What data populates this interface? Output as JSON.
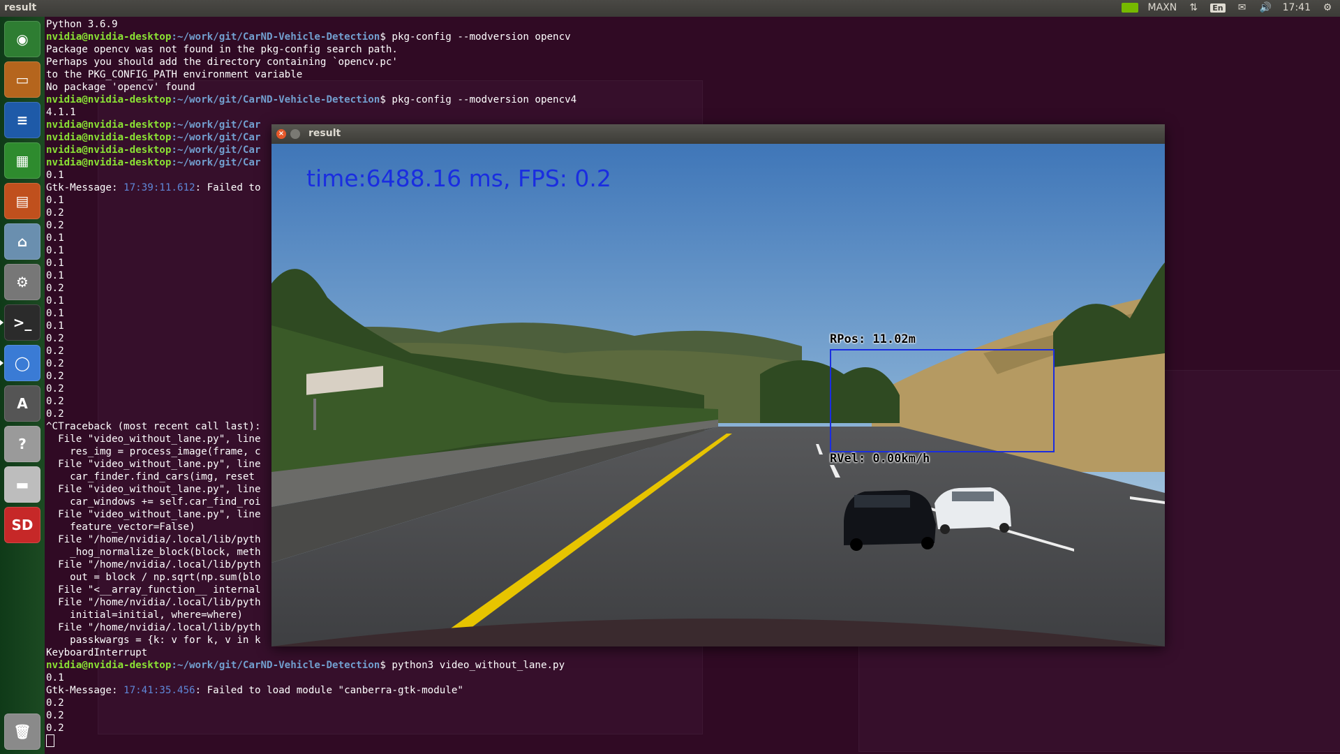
{
  "top_panel": {
    "app_title": "result",
    "nvidia_mode": "MAXN",
    "input_lang": "En",
    "clock": "17:41",
    "icons": [
      "nvidia-icon",
      "network-icon",
      "keyboard-icon",
      "mail-icon",
      "volume-icon",
      "gear-icon"
    ]
  },
  "launcher": {
    "items": [
      {
        "name": "launcher-ubuntu-icon",
        "glyph": "◉",
        "color": "#2e7d32"
      },
      {
        "name": "launcher-files-icon",
        "glyph": "▭",
        "color": "#b5651d"
      },
      {
        "name": "launcher-writer-icon",
        "glyph": "≡",
        "color": "#1e5aa8"
      },
      {
        "name": "launcher-calc-icon",
        "glyph": "▦",
        "color": "#2e8b2e"
      },
      {
        "name": "launcher-impress-icon",
        "glyph": "▤",
        "color": "#c0501d"
      },
      {
        "name": "launcher-software-icon",
        "glyph": "⌂",
        "color": "#6a8faf"
      },
      {
        "name": "launcher-settings-icon",
        "glyph": "⚙",
        "color": "#777777"
      },
      {
        "name": "launcher-terminal-icon",
        "glyph": ">_",
        "color": "#2b2b2b"
      },
      {
        "name": "launcher-chromium-icon",
        "glyph": "◯",
        "color": "#3a7bd5"
      },
      {
        "name": "launcher-updater-icon",
        "glyph": "A",
        "color": "#555555"
      },
      {
        "name": "launcher-help-icon",
        "glyph": "?",
        "color": "#9a9a9a"
      },
      {
        "name": "launcher-drive-icon",
        "glyph": "▬",
        "color": "#bdbdbd"
      },
      {
        "name": "launcher-sdcard-icon",
        "glyph": "SD",
        "color": "#c62828"
      },
      {
        "name": "launcher-trash-icon",
        "glyph": "🗑",
        "color": "#8a8a8a"
      }
    ]
  },
  "terminal": {
    "prompt_user": "nvidia@nvidia-desktop",
    "prompt_path": ":~/work/git/CarND-Vehicle-Detection",
    "prompt_path_cut": ":~/work/git/Car",
    "lines": [
      {
        "t": "Python 3.6.9"
      },
      {
        "p": "full",
        "t": "$ pkg-config --modversion opencv"
      },
      {
        "t": "Package opencv was not found in the pkg-config search path."
      },
      {
        "t": "Perhaps you should add the directory containing `opencv.pc'"
      },
      {
        "t": "to the PKG_CONFIG_PATH environment variable"
      },
      {
        "t": "No package 'opencv' found"
      },
      {
        "p": "full",
        "t": "$ pkg-config --modversion opencv4"
      },
      {
        "t": "4.1.1"
      },
      {
        "p": "cut",
        "t": ""
      },
      {
        "p": "cut",
        "t": ""
      },
      {
        "p": "cut",
        "t": ""
      },
      {
        "p": "cut",
        "t": ""
      },
      {
        "t": "0.1"
      },
      {
        "g": "Gtk-Message",
        "ts": "17:39:11.612",
        "t": ": Failed to"
      },
      {
        "t": "0.1"
      },
      {
        "t": "0.2"
      },
      {
        "t": "0.2"
      },
      {
        "t": "0.1"
      },
      {
        "t": "0.1"
      },
      {
        "t": "0.1"
      },
      {
        "t": "0.1"
      },
      {
        "t": "0.2"
      },
      {
        "t": "0.1"
      },
      {
        "t": "0.1"
      },
      {
        "t": "0.1"
      },
      {
        "t": "0.2"
      },
      {
        "t": "0.2"
      },
      {
        "t": "0.2"
      },
      {
        "t": "0.2"
      },
      {
        "t": "0.2"
      },
      {
        "t": "0.2"
      },
      {
        "t": "0.2"
      },
      {
        "t": "^CTraceback (most recent call last):"
      },
      {
        "t": "  File \"video_without_lane.py\", line"
      },
      {
        "t": "    res_img = process_image(frame, c"
      },
      {
        "t": "  File \"video_without_lane.py\", line"
      },
      {
        "t": "    car_finder.find_cars(img, reset"
      },
      {
        "t": "  File \"video_without_lane.py\", line"
      },
      {
        "t": "    car_windows += self.car_find_roi"
      },
      {
        "t": "  File \"video_without_lane.py\", line"
      },
      {
        "t": "    feature_vector=False)"
      },
      {
        "t": "  File \"/home/nvidia/.local/lib/pyth"
      },
      {
        "t": "    _hog_normalize_block(block, meth"
      },
      {
        "t": "  File \"/home/nvidia/.local/lib/pyth"
      },
      {
        "t": "    out = block / np.sqrt(np.sum(blo"
      },
      {
        "t": "  File \"<__array_function__ internal"
      },
      {
        "t": "  File \"/home/nvidia/.local/lib/pyth"
      },
      {
        "t": "    initial=initial, where=where)"
      },
      {
        "t": "  File \"/home/nvidia/.local/lib/pyth"
      },
      {
        "t": "    passkwargs = {k: v for k, v in k"
      },
      {
        "t": "KeyboardInterrupt"
      },
      {
        "p": "full",
        "t": "$ python3 video_without_lane.py"
      },
      {
        "t": "0.1"
      },
      {
        "g": "Gtk-Message",
        "ts": "17:41:35.456",
        "t": ": Failed to load module \"canberra-gtk-module\""
      },
      {
        "t": "0.2"
      },
      {
        "t": "0.2"
      },
      {
        "t": "0.2"
      },
      {
        "cursor": true
      }
    ]
  },
  "result_window": {
    "title": "result",
    "hud_text": "time:6488.16 ms, FPS: 0.2",
    "detection": {
      "rpos_label": "RPos:  11.02m",
      "rvel_label": "RVel:   0.00km/h",
      "box_color": "#1a2de0"
    }
  },
  "colors": {
    "desktop_bg": "#300a24",
    "prompt_user": "#8ae234",
    "prompt_path": "#729fcf",
    "hud_text": "#1a2de0"
  }
}
